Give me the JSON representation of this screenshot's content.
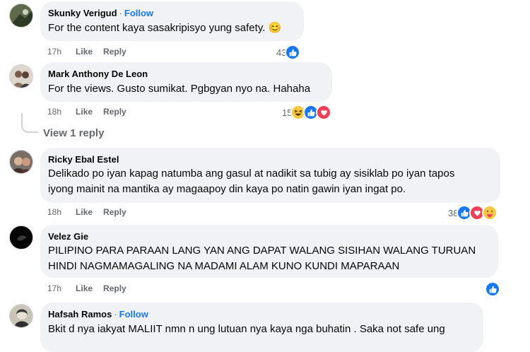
{
  "comments": [
    {
      "author": "Skunky Verigud",
      "follow": "Follow",
      "text": "For the content kaya sasakripisyo yung safety. 😊",
      "time": "17h",
      "like": "Like",
      "reply": "Reply",
      "reaction_count": "43",
      "reactions": [
        "like"
      ]
    },
    {
      "author": "Mark Anthony De Leon",
      "text": "For the views. Gusto sumikat. Pgbgyan nyo na. Hahaha",
      "time": "18h",
      "like": "Like",
      "reply": "Reply",
      "reaction_count": "15",
      "reactions": [
        "haha",
        "like",
        "love"
      ],
      "view_replies": "View 1 reply"
    },
    {
      "author": "Ricky Ebal Estel",
      "text_lines": [
        "Delikado po iyan kapag natumba ang gasul at nadikit sa tubig ay sisiklab po iyan tapos",
        "iyong mainit na mantika ay magaapoy din kaya po natin gawin iyan ingat po."
      ],
      "time": "18h",
      "like": "Like",
      "reply": "Reply",
      "reaction_count": "38",
      "reactions": [
        "like",
        "love",
        "care"
      ]
    },
    {
      "author": "Velez Gie",
      "text_lines": [
        "PILIPINO PARA PARAAN LANG YAN ANG DAPAT WALANG SISIHAN WALANG TURUAN",
        "HINDI NAGMAMAGALING NA MADAMI ALAM KUNO KUNDI MAPARAAN"
      ],
      "time": "17h",
      "like": "Like",
      "reply": "Reply",
      "reactions": [
        "like"
      ]
    },
    {
      "author": "Hafsah Ramos",
      "follow": "Follow",
      "text_lines": [
        "Bkit d nya iakyat MALIIT nmn n ung lutuan nya kaya nga buhatin . Saka not safe ung"
      ]
    }
  ],
  "colors": {
    "bubble": "#f0f2f5",
    "follow": "#1877f2",
    "meta": "#65676b",
    "like": "#1877f2",
    "love": "#f33e58",
    "haha": "#f7c844"
  },
  "icons": {
    "dot": "·"
  }
}
